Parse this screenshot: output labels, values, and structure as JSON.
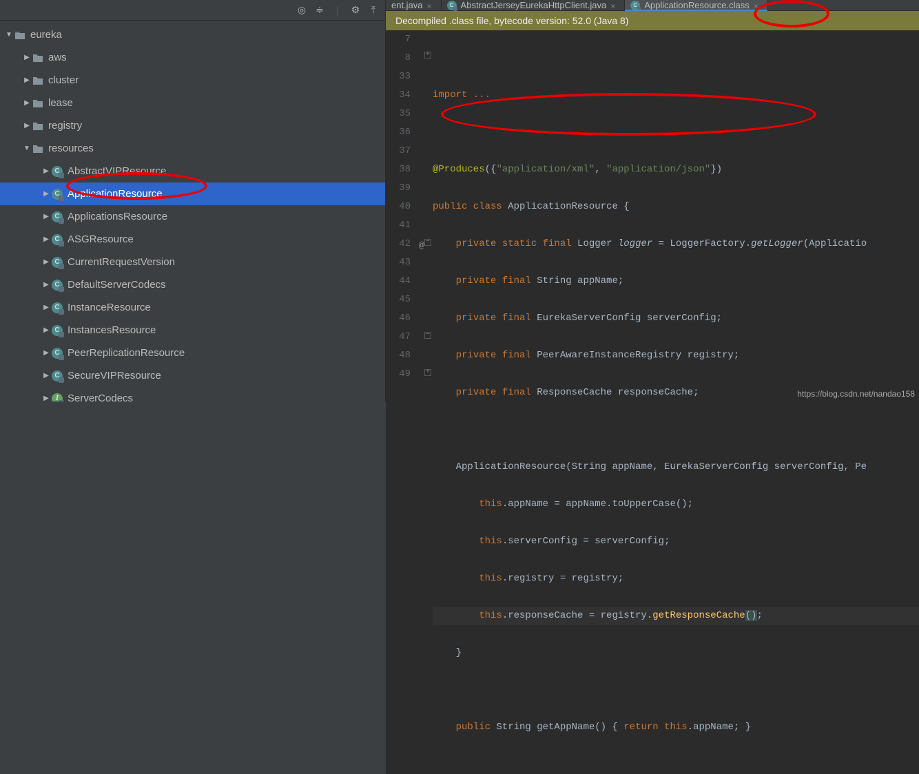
{
  "toolbar_icons": [
    "target-icon",
    "flatten-icon",
    "gear-icon",
    "hide-icon"
  ],
  "tree": {
    "root": {
      "label": "eureka",
      "expanded": true
    },
    "children": [
      {
        "label": "aws",
        "expanded": false,
        "icon": "folder"
      },
      {
        "label": "cluster",
        "expanded": false,
        "icon": "folder"
      },
      {
        "label": "lease",
        "expanded": false,
        "icon": "folder"
      },
      {
        "label": "registry",
        "expanded": false,
        "icon": "folder"
      },
      {
        "label": "resources",
        "expanded": true,
        "icon": "folder",
        "items": [
          {
            "label": "AbstractVIPResource",
            "selected": false
          },
          {
            "label": "ApplicationResource",
            "selected": true
          },
          {
            "label": "ApplicationsResource",
            "selected": false
          },
          {
            "label": "ASGResource",
            "selected": false
          },
          {
            "label": "CurrentRequestVersion",
            "selected": false
          },
          {
            "label": "DefaultServerCodecs",
            "selected": false
          },
          {
            "label": "InstanceResource",
            "selected": false
          },
          {
            "label": "InstancesResource",
            "selected": false
          },
          {
            "label": "PeerReplicationResource",
            "selected": false
          },
          {
            "label": "SecureVIPResource",
            "selected": false
          },
          {
            "label": "ServerCodecs",
            "selected": false,
            "green": true
          }
        ]
      }
    ]
  },
  "tabs": [
    {
      "label": "ent.java",
      "active": false
    },
    {
      "label": "AbstractJerseyEurekaHttpClient.java",
      "active": false
    },
    {
      "label": "ApplicationResource.class",
      "active": true
    }
  ],
  "banner": "Decompiled .class file, bytecode version: 52.0 (Java 8)",
  "code": {
    "line_nums": [
      "7",
      "8",
      "33",
      "34",
      "35",
      "36",
      "37",
      "38",
      "39",
      "40",
      "41",
      "42",
      "43",
      "44",
      "45",
      "46",
      "47",
      "48",
      "49"
    ],
    "l7": "",
    "l8_a": "import ",
    "l8_b": "...",
    "l34_a": "@Produces",
    "l34_b": "({",
    "l34_c": "\"application/xml\"",
    "l34_d": ", ",
    "l34_e": "\"application/json\"",
    "l34_f": "})",
    "l35_a": "public class ",
    "l35_b": "ApplicationResource {",
    "l36_a": "    private static final ",
    "l36_b": "Logger ",
    "l36_c": "logger",
    "l36_d": " = LoggerFactory.",
    "l36_e": "getLogger",
    "l36_f": "(Applicatio",
    "l37_a": "    private final ",
    "l37_b": "String appName;",
    "l38_a": "    private final ",
    "l38_b": "EurekaServerConfig serverConfig;",
    "l39_a": "    private final ",
    "l39_b": "PeerAwareInstanceRegistry registry;",
    "l40_a": "    private final ",
    "l40_b": "ResponseCache responseCache;",
    "l41": "",
    "l42_a": "    ApplicationResource(String appName, EurekaServerConfig serverConfig, Pe",
    "l43_a": "        this",
    "l43_b": ".appName = appName.toUpperCase();",
    "l44_a": "        this",
    "l44_b": ".serverConfig = serverConfig;",
    "l45_a": "        this",
    "l45_b": ".registry = registry;",
    "l46_a": "        this",
    "l46_b": ".responseCache = registry.",
    "l46_c": "getResponseCache",
    "l46_d": "(",
    "l46_e": ")",
    "l46_f": ";",
    "l47": "    }",
    "l48": "",
    "l49_a": "    public ",
    "l49_b": "String getAppName() { ",
    "l49_c": "return this",
    "l49_d": ".appName; }"
  },
  "watermark": "https://blog.csdn.net/nandao158"
}
